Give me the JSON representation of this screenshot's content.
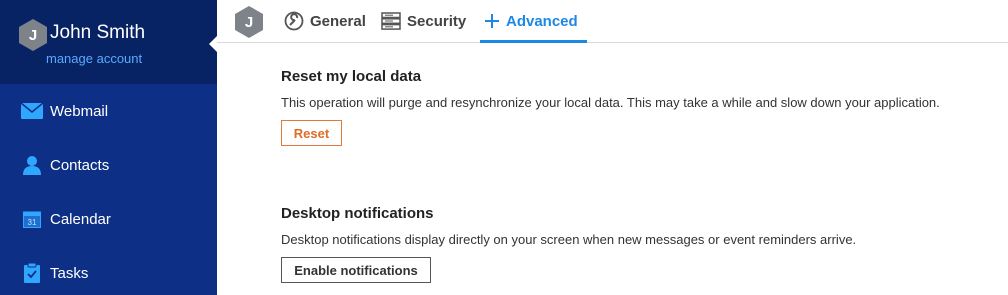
{
  "account": {
    "avatar_initial": "J",
    "name": "John Smith",
    "manage_label": "manage account"
  },
  "sidebar": {
    "items": [
      {
        "label": "Webmail",
        "icon": "envelope-icon"
      },
      {
        "label": "Contacts",
        "icon": "person-icon"
      },
      {
        "label": "Calendar",
        "icon": "calendar-icon",
        "icon_text": "31"
      },
      {
        "label": "Tasks",
        "icon": "clipboard-icon"
      }
    ]
  },
  "topbar": {
    "avatar_initial": "J",
    "tabs": [
      {
        "label": "General",
        "icon": "wrench-icon",
        "active": false
      },
      {
        "label": "Security",
        "icon": "server-icon",
        "active": false
      },
      {
        "label": "Advanced",
        "icon": "plus-icon",
        "active": true
      }
    ]
  },
  "sections": {
    "reset": {
      "title": "Reset my local data",
      "description": "This operation will purge and resynchronize your local data. This may take a while and slow down your application.",
      "button_label": "Reset"
    },
    "notifications": {
      "title": "Desktop notifications",
      "description": "Desktop notifications display directly on your screen when new messages or event reminders arrive.",
      "button_label": "Enable notifications"
    }
  },
  "colors": {
    "sidebar_bg": "#0d2f86",
    "account_bg": "#072363",
    "accent": "#1e88e5",
    "icon_blue": "#2fa7ff",
    "reset_orange": "#e06c26"
  }
}
